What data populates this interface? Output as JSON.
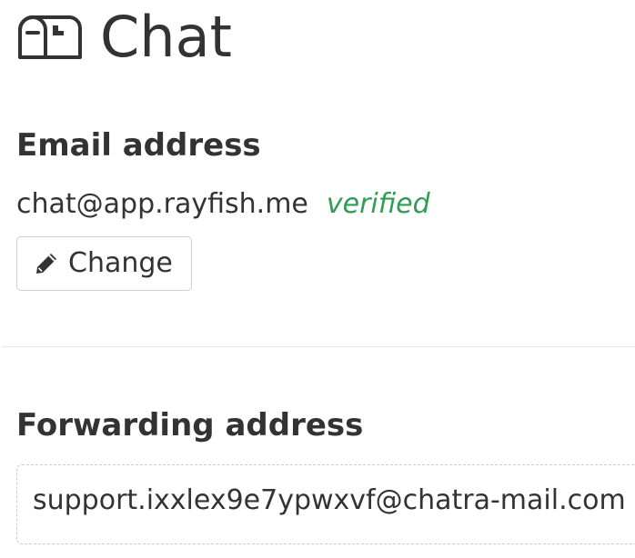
{
  "header": {
    "title": "Chat",
    "icon": "mailbox-icon"
  },
  "email_section": {
    "heading": "Email address",
    "address": "chat@app.rayfish.me",
    "status": "verified",
    "status_color": "#2f9e52",
    "change_button": {
      "label": "Change",
      "icon": "pencil-icon"
    }
  },
  "forwarding_section": {
    "heading": "Forwarding address",
    "address": "support.ixxlex9e7ypwxvf@chatra-mail.com"
  }
}
